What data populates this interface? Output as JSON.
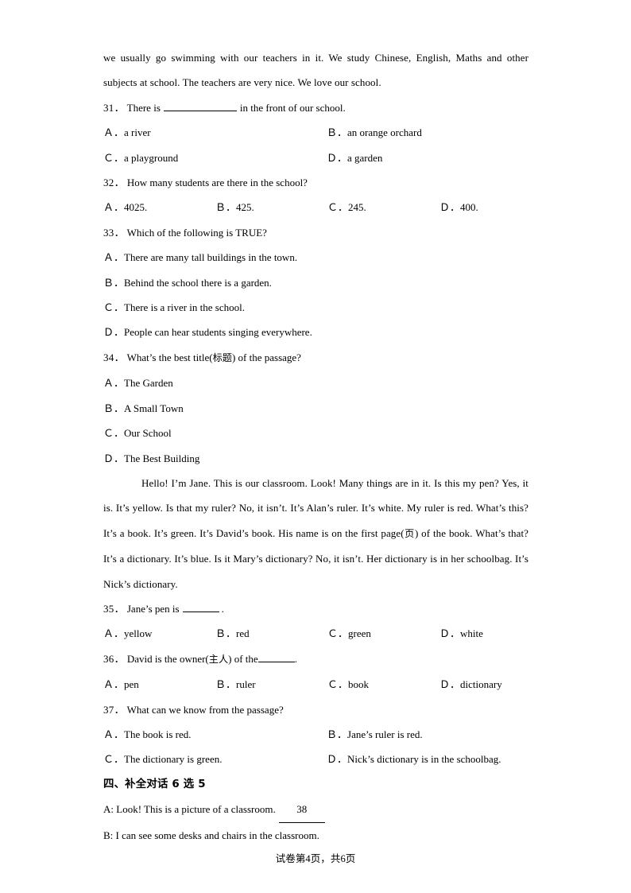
{
  "passages": [
    {
      "id": "passage-school",
      "indent": false,
      "text": "we usually go swimming with our teachers in it. We study Chinese, English, Maths and other subjects at school. The teachers are very nice. We love our school."
    },
    {
      "id": "passage-classroom",
      "indent": true,
      "text_part1": "Hello! I’m Jane. This is our classroom. Look! Many things are in it. Is this my pen? Yes, it is. It’s yellow. Is that my ruler? No, it isn’t. It’s Alan’s ruler. It’s white. My ruler is red. What’s this? It’s a book. It’s green. It’s David’s book. His name is on the first page(",
      "gloss": "页",
      "text_part2": ") of the book. What’s that? It’s a dictionary. It’s blue. Is it Mary’s dictionary? No, it isn’t. Her dictionary is in her schoolbag. It’s Nick’s dictionary."
    }
  ],
  "questions": [
    {
      "number": "31",
      "sep": "．",
      "stem_before": "There is",
      "stem_after": "in the front of our school.",
      "blank": "long",
      "layout": "cols2",
      "options": [
        {
          "mark": "Ａ．",
          "text": "a river"
        },
        {
          "mark": "Ｂ．",
          "text": "an orange orchard"
        },
        {
          "mark": "Ｃ．",
          "text": "a playground"
        },
        {
          "mark": "Ｄ．",
          "text": "a garden"
        }
      ]
    },
    {
      "number": "32",
      "sep": "．",
      "stem": "How many students are there in the school?",
      "layout": "cols4",
      "options": [
        {
          "mark": "Ａ．",
          "text": "4025."
        },
        {
          "mark": "Ｂ．",
          "text": "425."
        },
        {
          "mark": "Ｃ．",
          "text": "245."
        },
        {
          "mark": "Ｄ．",
          "text": "400."
        }
      ]
    },
    {
      "number": "33",
      "sep": "．",
      "stem": "Which of the following is TRUE?",
      "layout": "cols1",
      "options": [
        {
          "mark": "Ａ．",
          "text": "There are many tall buildings in the town."
        },
        {
          "mark": "Ｂ．",
          "text": "Behind the school there is a garden."
        },
        {
          "mark": "Ｃ．",
          "text": "There is a river in the school."
        },
        {
          "mark": "Ｄ．",
          "text": "People can hear students singing everywhere."
        }
      ]
    },
    {
      "number": "34",
      "sep": "．",
      "stem_before": "What’s the best title(",
      "gloss": "标题",
      "stem_after": ") of the passage?",
      "layout": "cols1",
      "options": [
        {
          "mark": "Ａ．",
          "text": "The Garden"
        },
        {
          "mark": "Ｂ．",
          "text": "A Small Town"
        },
        {
          "mark": "Ｃ．",
          "text": "Our School"
        },
        {
          "mark": "Ｄ．",
          "text": "The Best Building"
        }
      ]
    },
    {
      "number": "35",
      "sep": "．",
      "stem_before": "Jane’s pen is",
      "stem_after": ".",
      "blank": "mid",
      "layout": "cols4",
      "options": [
        {
          "mark": "Ａ．",
          "text": "yellow"
        },
        {
          "mark": "Ｂ．",
          "text": "red"
        },
        {
          "mark": "Ｃ．",
          "text": "green"
        },
        {
          "mark": "Ｄ．",
          "text": "white"
        }
      ]
    },
    {
      "number": "36",
      "sep": "．",
      "stem_before": "David is the owner(",
      "gloss": "主人",
      "stem_mid": ") of the",
      "stem_after": ".",
      "blank": "tight",
      "layout": "cols4",
      "options": [
        {
          "mark": "Ａ．",
          "text": "pen"
        },
        {
          "mark": "Ｂ．",
          "text": "ruler"
        },
        {
          "mark": "Ｃ．",
          "text": "book"
        },
        {
          "mark": "Ｄ．",
          "text": "dictionary"
        }
      ]
    },
    {
      "number": "37",
      "sep": "．",
      "stem": "What can we know from the passage?",
      "layout": "cols2",
      "options": [
        {
          "mark": "Ａ．",
          "text": "The book is red."
        },
        {
          "mark": "Ｂ．",
          "text": "Jane’s ruler is red."
        },
        {
          "mark": "Ｃ．",
          "text": "The dictionary is green."
        },
        {
          "mark": "Ｄ．",
          "text": "Nick’s dictionary is in the schoolbag."
        }
      ]
    }
  ],
  "section": {
    "heading": "四、补全对话 6 选 5"
  },
  "dialogue": [
    {
      "speaker_line": "A: Look! This is a picture of a classroom.",
      "blank_number": "38"
    },
    {
      "speaker_line": "B: I can see some desks and chairs in the classroom.",
      "blank_number": ""
    }
  ],
  "footer": {
    "prefix": "试卷第",
    "page": "4",
    "middle": "页，共",
    "total": "6",
    "suffix": "页"
  }
}
